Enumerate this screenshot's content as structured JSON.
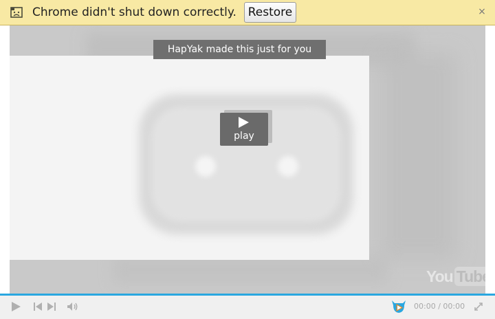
{
  "infobar": {
    "message": "Chrome didn't shut down correctly.",
    "restore_label": "Restore",
    "close_glyph": "×",
    "warning_icon": "sad-page-icon",
    "bg_color": "#f8e9a4"
  },
  "video": {
    "banner_text": "HapYak made this just for you",
    "play_label": "play",
    "watermark_you": "You",
    "watermark_tube": "Tube"
  },
  "controls": {
    "time_current": "00:00",
    "time_separator": " / ",
    "time_total": "00:00",
    "progress_color": "#2aa7e0",
    "icons": [
      "play-icon",
      "previous-icon",
      "next-icon",
      "volume-icon",
      "hapyak-logo-icon",
      "fullscreen-icon"
    ]
  }
}
